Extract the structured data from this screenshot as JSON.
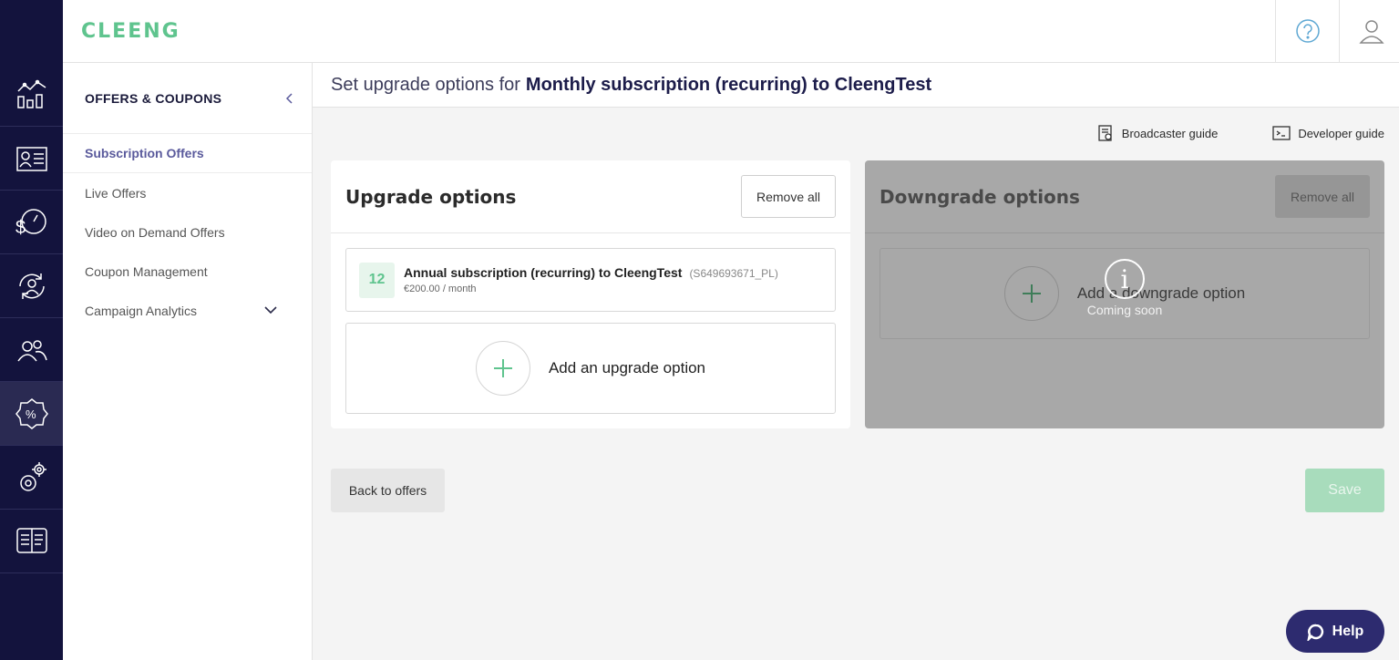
{
  "app": {
    "logo_text": "CLEENG",
    "brand_color": "#5fc48e",
    "nav_color": "#13133d"
  },
  "rail": {
    "items": [
      {
        "icon": "analytics-icon"
      },
      {
        "icon": "customer-card-icon"
      },
      {
        "icon": "revenue-speed-icon"
      },
      {
        "icon": "user-refresh-icon"
      },
      {
        "icon": "users-icon"
      },
      {
        "icon": "offers-percent-icon",
        "active": true
      },
      {
        "icon": "settings-icon"
      },
      {
        "icon": "docs-book-icon"
      }
    ]
  },
  "topbar": {
    "help_icon": "question-icon",
    "account_icon": "user-icon"
  },
  "subnav": {
    "title": "OFFERS & COUPONS",
    "items": [
      {
        "label": "Subscription Offers",
        "active": true
      },
      {
        "label": "Live Offers"
      },
      {
        "label": "Video on Demand Offers"
      },
      {
        "label": "Coupon Management"
      },
      {
        "label": "Campaign Analytics"
      }
    ]
  },
  "page": {
    "title_prefix": "Set upgrade options for",
    "title_subject": "Monthly subscription (recurring) to CleengTest"
  },
  "guides": {
    "broadcaster": "Broadcaster guide",
    "developer": "Developer guide"
  },
  "upgrade": {
    "title": "Upgrade options",
    "remove_all": "Remove all",
    "offer": {
      "badge": "12",
      "title": "Annual subscription (recurring) to CleengTest",
      "id": "(S649693671_PL)",
      "price": "€200.00 / month"
    },
    "add_label": "Add an upgrade option"
  },
  "downgrade": {
    "title": "Downgrade options",
    "remove_all": "Remove all",
    "add_label": "Add a downgrade option",
    "info_glyph": "i",
    "coming_soon": "Coming soon"
  },
  "footer": {
    "back": "Back to offers",
    "save": "Save"
  },
  "help": {
    "label": "Help"
  }
}
